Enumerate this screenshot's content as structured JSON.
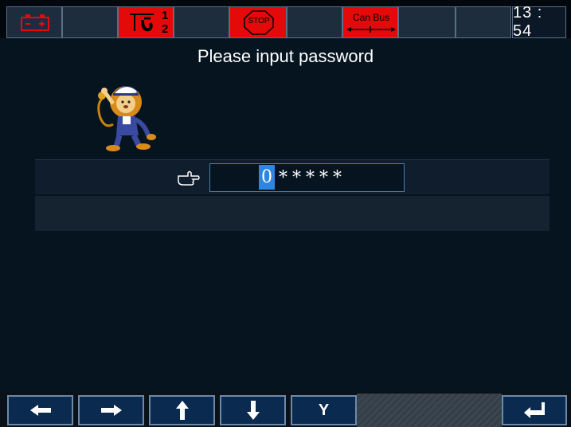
{
  "statusbar": {
    "icons": [
      "battery-icon",
      "boom-icon",
      "stop-icon",
      "canbus-icon"
    ],
    "boom_digits": [
      "1",
      "2"
    ],
    "stop_text": "STOP",
    "canbus_text": "Can Bus",
    "clock": "13 : 54",
    "colors": {
      "alert": "#e40a0a",
      "cell": "#1e2d3e"
    }
  },
  "main": {
    "title": "Please input password",
    "password": {
      "current_digit": "0",
      "masked": "*****"
    }
  },
  "bottombar": {
    "buttons": [
      {
        "icon": "arrow-left-icon"
      },
      {
        "icon": "arrow-right-icon"
      },
      {
        "icon": "arrow-up-icon"
      },
      {
        "icon": "arrow-down-icon"
      },
      {
        "label": "Y"
      },
      {
        "icon": "enter-icon"
      }
    ]
  }
}
